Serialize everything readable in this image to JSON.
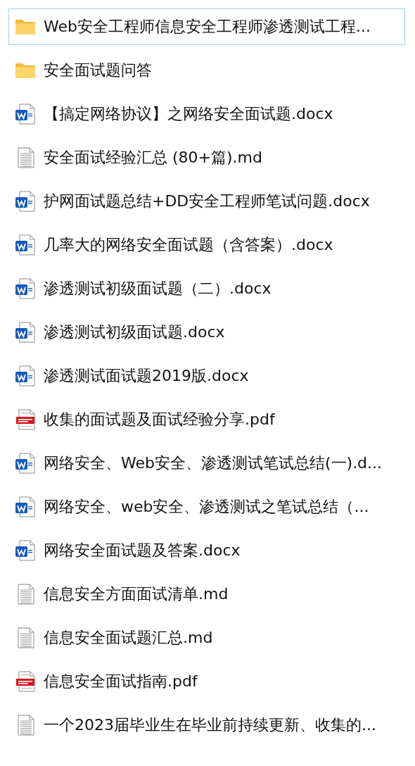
{
  "files": [
    {
      "name": "Web安全工程师信息安全工程师渗透测试工程...",
      "kind": "folder",
      "selected": true
    },
    {
      "name": "安全面试题问答",
      "kind": "folder",
      "selected": false
    },
    {
      "name": "【搞定网络协议】之网络安全面试题.docx",
      "kind": "word",
      "selected": false
    },
    {
      "name": "安全面试经验汇总 (80+篇).md",
      "kind": "text",
      "selected": false
    },
    {
      "name": "护网面试题总结+DD安全工程师笔试问题.docx",
      "kind": "word",
      "selected": false
    },
    {
      "name": "几率大的网络安全面试题（含答案）.docx",
      "kind": "word",
      "selected": false
    },
    {
      "name": "渗透测试初级面试题（二）.docx",
      "kind": "word",
      "selected": false
    },
    {
      "name": "渗透测试初级面试题.docx",
      "kind": "word",
      "selected": false
    },
    {
      "name": "渗透测试面试题2019版.docx",
      "kind": "word",
      "selected": false
    },
    {
      "name": "收集的面试题及面试经验分享.pdf",
      "kind": "pdf",
      "selected": false
    },
    {
      "name": "网络安全、Web安全、渗透测试笔试总结(一).d...",
      "kind": "word",
      "selected": false
    },
    {
      "name": "网络安全、web安全、渗透测试之笔试总结（...",
      "kind": "word",
      "selected": false
    },
    {
      "name": "网络安全面试题及答案.docx",
      "kind": "word",
      "selected": false
    },
    {
      "name": "信息安全方面面试清单.md",
      "kind": "text",
      "selected": false
    },
    {
      "name": "信息安全面试题汇总.md",
      "kind": "text",
      "selected": false
    },
    {
      "name": "信息安全面试指南.pdf",
      "kind": "pdf",
      "selected": false
    },
    {
      "name": "一个2023届毕业生在毕业前持续更新、收集的...",
      "kind": "text",
      "selected": false
    }
  ]
}
